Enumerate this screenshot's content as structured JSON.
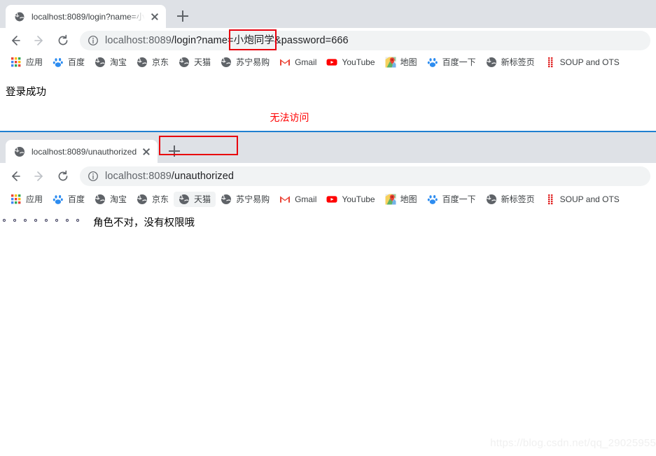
{
  "windows": [
    {
      "id": "window-login",
      "tab": {
        "title": "localhost:8089/login?name=小",
        "favicon": "globe-icon",
        "close_label": "×"
      },
      "newtab_label": "+",
      "toolbar": {
        "back": "back-arrow",
        "forward": "forward-arrow",
        "reload": "reload-arrow",
        "info": "info-circle-icon",
        "url_prefix": "localhost:8089",
        "url_path": "/login?name=",
        "url_highlight": "小炮同学",
        "url_suffix": "&password=666"
      },
      "annotation": {
        "type": "red-rectangle",
        "target": "小炮同学",
        "color": "#e8000d"
      },
      "content": {
        "message_primary": "登录成功",
        "message_error": "无法访问",
        "error_color": "#ff0000"
      }
    },
    {
      "id": "window-unauthorized",
      "tab": {
        "title": "localhost:8089/unauthorized",
        "favicon": "globe-icon",
        "close_label": "×"
      },
      "newtab_label": "+",
      "toolbar": {
        "back": "back-arrow",
        "forward": "forward-arrow",
        "reload": "reload-arrow",
        "info": "info-circle-icon",
        "url_prefix": "localhost:8089",
        "url_highlight": "/unauthorized"
      },
      "annotation": {
        "type": "red-rectangle",
        "target": "/unauthorized",
        "color": "#e8000d"
      },
      "content": {
        "dots_count": 8,
        "message": "角色不对，没有权限哦"
      }
    }
  ],
  "bookmarks": [
    {
      "label": "应用",
      "icon": "apps-grid-icon"
    },
    {
      "label": "百度",
      "icon": "baidu-paw-icon"
    },
    {
      "label": "淘宝",
      "icon": "globe-icon"
    },
    {
      "label": "京东",
      "icon": "globe-icon"
    },
    {
      "label": "天猫",
      "icon": "globe-icon"
    },
    {
      "label": "苏宁易购",
      "icon": "globe-icon"
    },
    {
      "label": "Gmail",
      "icon": "gmail-m-icon"
    },
    {
      "label": "YouTube",
      "icon": "youtube-play-icon"
    },
    {
      "label": "地图",
      "icon": "google-maps-pin-icon"
    },
    {
      "label": "百度一下",
      "icon": "baidu-paw-icon"
    },
    {
      "label": "新标签页",
      "icon": "globe-icon"
    },
    {
      "label": "SOUP and OTS",
      "icon": "red-dots-icon"
    }
  ],
  "bookmarks_hovered_index_window2": 4,
  "watermark": "https://blog.csdn.net/qq_29025955",
  "colors": {
    "tabstrip_bg": "#dee1e6",
    "omnibox_bg": "#f1f3f4",
    "annotation_red": "#e8000d",
    "error_red": "#ff0000",
    "divider_blue": "#1f7fd0",
    "text_primary": "#202124"
  }
}
